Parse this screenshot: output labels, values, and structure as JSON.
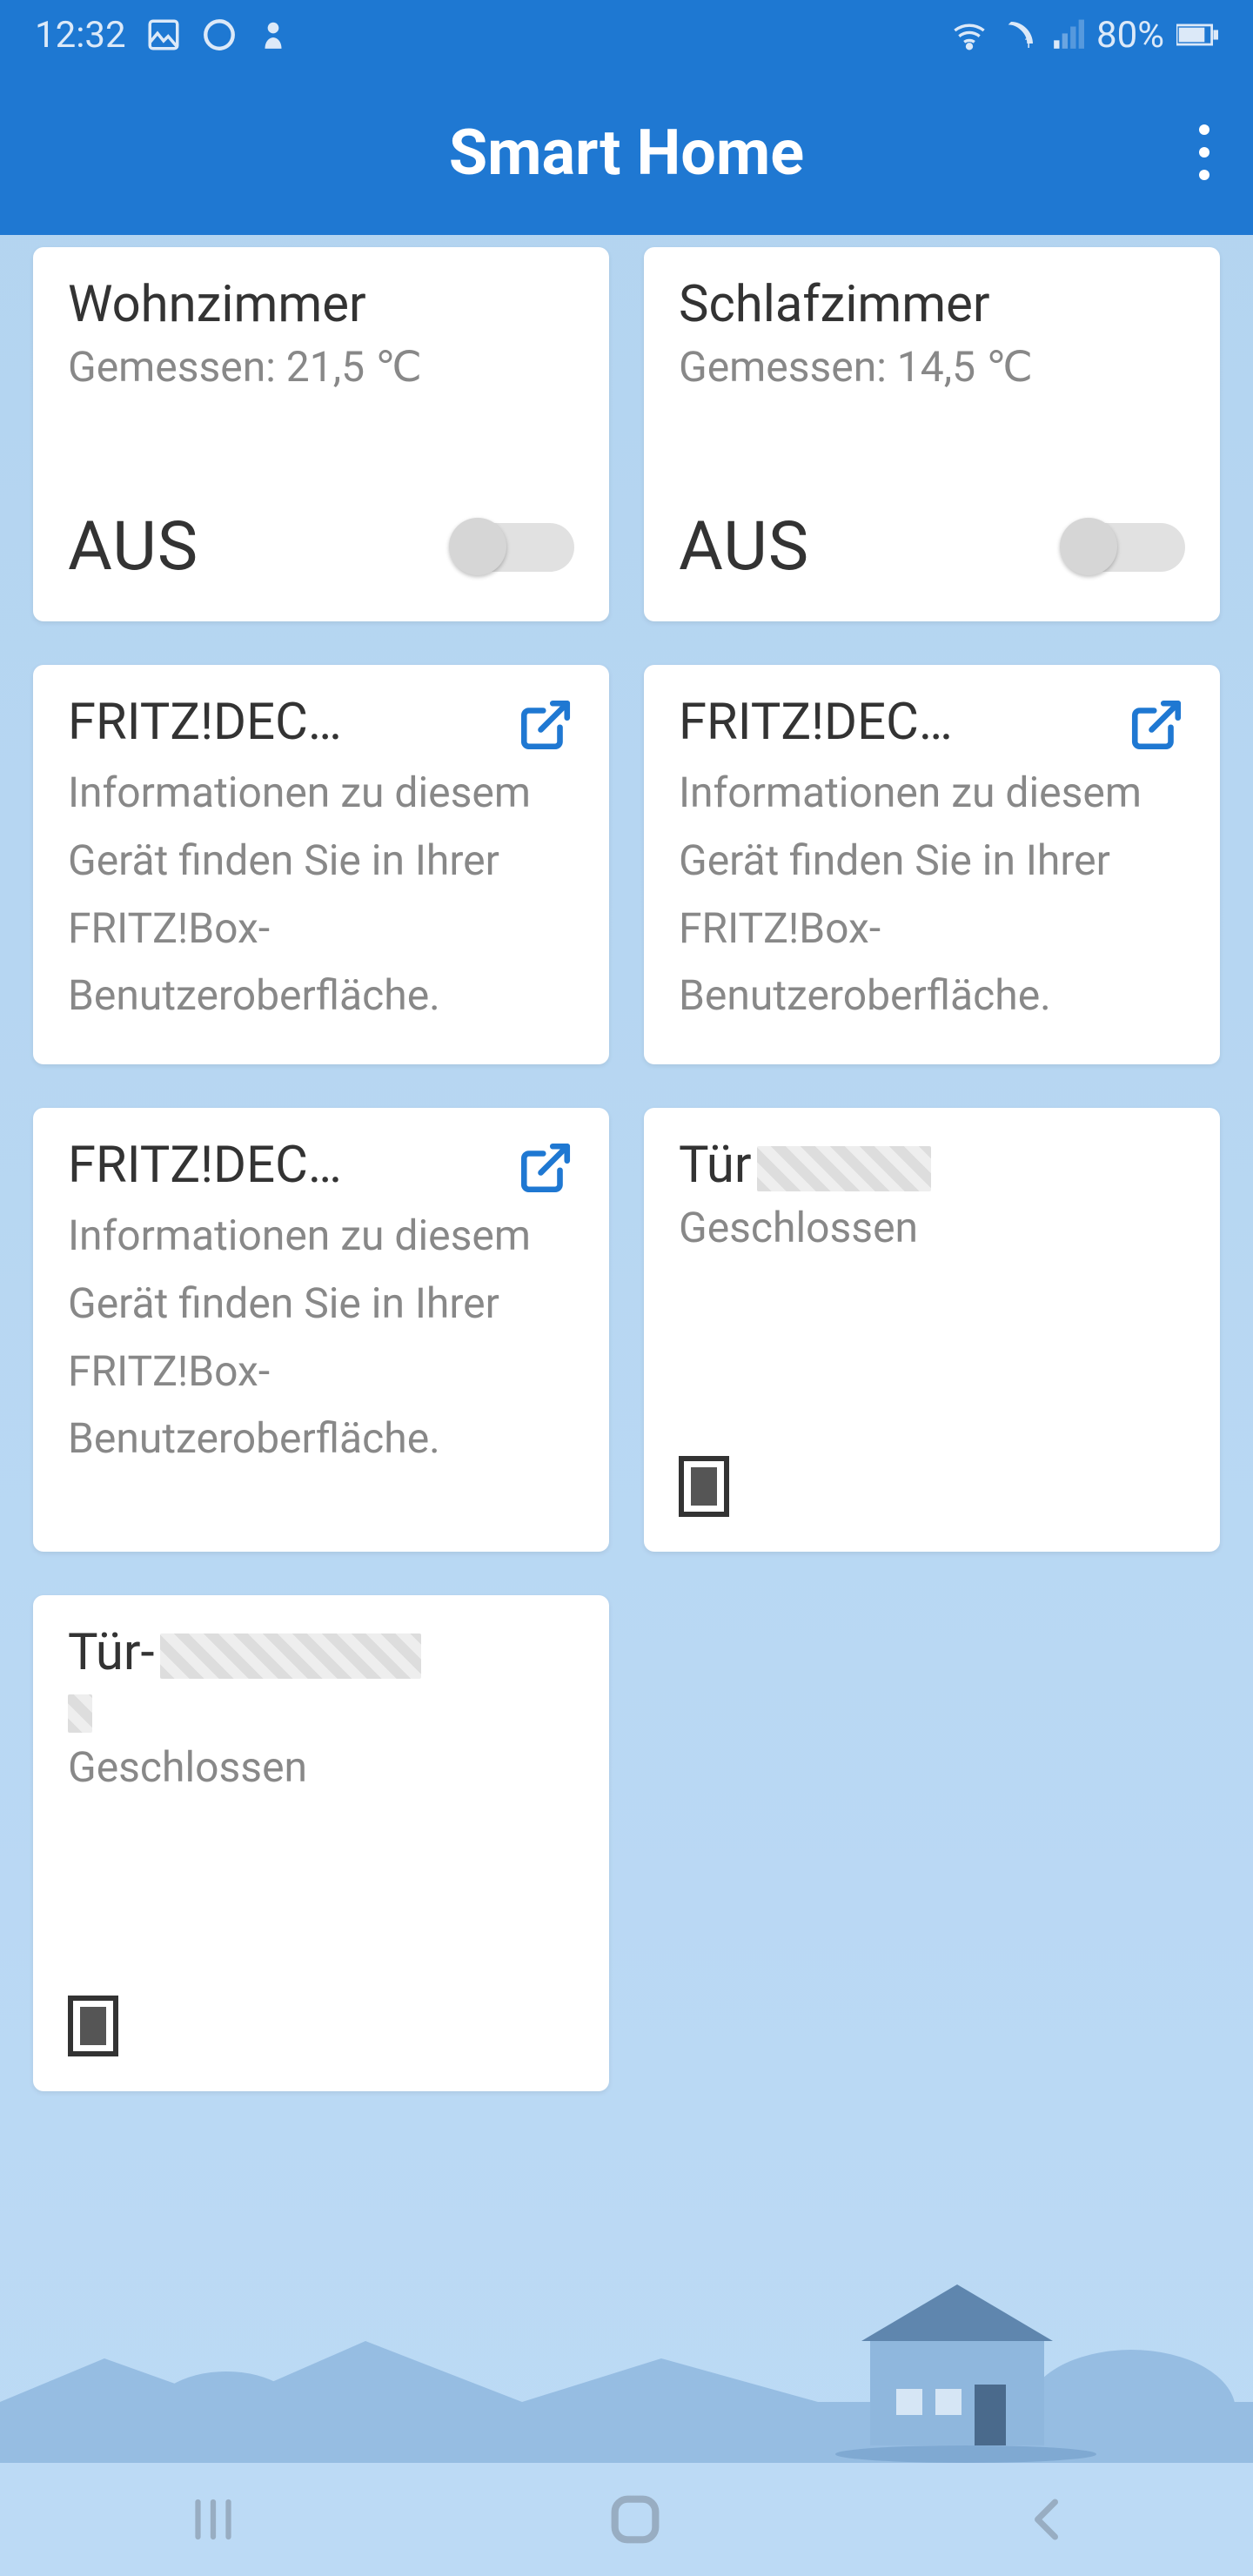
{
  "statusbar": {
    "time": "12:32",
    "battery": "80%"
  },
  "appbar": {
    "title": "Smart Home"
  },
  "cards": {
    "temp1": {
      "title": "Wohnzimmer",
      "subtitle": "Gemessen: 21,5 ℃",
      "state": "AUS",
      "on": false
    },
    "temp2": {
      "title": "Schlafzimmer",
      "subtitle": "Gemessen: 14,5 ℃",
      "state": "AUS",
      "on": false
    },
    "info": {
      "title": "FRITZ!DEC…",
      "desc": "Informationen zu diesem Gerät finden Sie in Ihrer FRITZ!Box-Benutzeroberfläche."
    },
    "door1": {
      "title": "Tür",
      "state": "Geschlossen"
    },
    "door2": {
      "title": "Tür-",
      "state": "Geschlossen"
    }
  }
}
